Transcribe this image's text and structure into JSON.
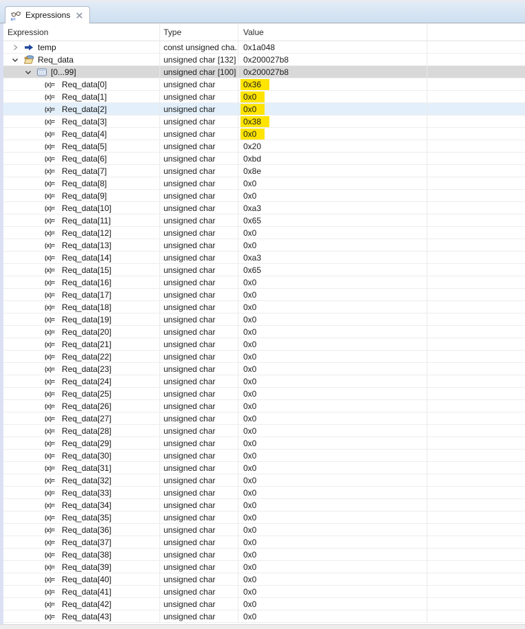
{
  "tab": {
    "label": "Expressions"
  },
  "columns": [
    {
      "label": "Expression"
    },
    {
      "label": "Type"
    },
    {
      "label": "Value"
    },
    {
      "label": ""
    }
  ],
  "glyphs": {
    "variable": "(x)="
  },
  "colors": {
    "topstrip_bg": "#e9eaf2",
    "tabstrip_from": "#e2ecf7",
    "tabstrip_to": "#cddff0",
    "tabstrip_border": "#a4a9b6",
    "tab_border": "#b2b8c8",
    "left_border": "#dbe1f3",
    "col_divider": "#e9e9e9",
    "row_separator": "#ededed",
    "selected_row": "#d9d9d9",
    "hover_row": "#e3f0fb",
    "value_highlight": "#ffe400",
    "scrollbar_bg": "#ededed"
  },
  "rows": [
    {
      "level": 0,
      "chevron": "collapsed",
      "icon": "pointer-arrow",
      "label": "temp",
      "type": "const unsigned cha...",
      "value": "0x1a048"
    },
    {
      "level": 0,
      "chevron": "expanded",
      "icon": "open-folder",
      "label": "Req_data",
      "type": "unsigned char [132]",
      "value": "0x200027b8"
    },
    {
      "level": 1,
      "chevron": "expanded",
      "icon": "array-grid",
      "label": "[0...99]",
      "type": "unsigned char [100]",
      "value": "0x200027b8",
      "bg": "selected"
    },
    {
      "level": 2,
      "chevron": "none",
      "icon": "variable-xequals",
      "label": "Req_data[0]",
      "type": "unsigned char",
      "value": "0x36",
      "hl": true
    },
    {
      "level": 2,
      "chevron": "none",
      "icon": "variable-xequals",
      "label": "Req_data[1]",
      "type": "unsigned char",
      "value": "0x0",
      "hl": true
    },
    {
      "level": 2,
      "chevron": "none",
      "icon": "variable-xequals",
      "label": "Req_data[2]",
      "type": "unsigned char",
      "value": "0x0",
      "hl": true,
      "bg": "hover"
    },
    {
      "level": 2,
      "chevron": "none",
      "icon": "variable-xequals",
      "label": "Req_data[3]",
      "type": "unsigned char",
      "value": "0x38",
      "hl": true
    },
    {
      "level": 2,
      "chevron": "none",
      "icon": "variable-xequals",
      "label": "Req_data[4]",
      "type": "unsigned char",
      "value": "0x0",
      "hl": true
    },
    {
      "level": 2,
      "chevron": "none",
      "icon": "variable-xequals",
      "label": "Req_data[5]",
      "type": "unsigned char",
      "value": "0x20"
    },
    {
      "level": 2,
      "chevron": "none",
      "icon": "variable-xequals",
      "label": "Req_data[6]",
      "type": "unsigned char",
      "value": "0xbd"
    },
    {
      "level": 2,
      "chevron": "none",
      "icon": "variable-xequals",
      "label": "Req_data[7]",
      "type": "unsigned char",
      "value": "0x8e"
    },
    {
      "level": 2,
      "chevron": "none",
      "icon": "variable-xequals",
      "label": "Req_data[8]",
      "type": "unsigned char",
      "value": "0x0"
    },
    {
      "level": 2,
      "chevron": "none",
      "icon": "variable-xequals",
      "label": "Req_data[9]",
      "type": "unsigned char",
      "value": "0x0"
    },
    {
      "level": 2,
      "chevron": "none",
      "icon": "variable-xequals",
      "label": "Req_data[10]",
      "type": "unsigned char",
      "value": "0xa3"
    },
    {
      "level": 2,
      "chevron": "none",
      "icon": "variable-xequals",
      "label": "Req_data[11]",
      "type": "unsigned char",
      "value": "0x65"
    },
    {
      "level": 2,
      "chevron": "none",
      "icon": "variable-xequals",
      "label": "Req_data[12]",
      "type": "unsigned char",
      "value": "0x0"
    },
    {
      "level": 2,
      "chevron": "none",
      "icon": "variable-xequals",
      "label": "Req_data[13]",
      "type": "unsigned char",
      "value": "0x0"
    },
    {
      "level": 2,
      "chevron": "none",
      "icon": "variable-xequals",
      "label": "Req_data[14]",
      "type": "unsigned char",
      "value": "0xa3"
    },
    {
      "level": 2,
      "chevron": "none",
      "icon": "variable-xequals",
      "label": "Req_data[15]",
      "type": "unsigned char",
      "value": "0x65"
    },
    {
      "level": 2,
      "chevron": "none",
      "icon": "variable-xequals",
      "label": "Req_data[16]",
      "type": "unsigned char",
      "value": "0x0"
    },
    {
      "level": 2,
      "chevron": "none",
      "icon": "variable-xequals",
      "label": "Req_data[17]",
      "type": "unsigned char",
      "value": "0x0"
    },
    {
      "level": 2,
      "chevron": "none",
      "icon": "variable-xequals",
      "label": "Req_data[18]",
      "type": "unsigned char",
      "value": "0x0"
    },
    {
      "level": 2,
      "chevron": "none",
      "icon": "variable-xequals",
      "label": "Req_data[19]",
      "type": "unsigned char",
      "value": "0x0"
    },
    {
      "level": 2,
      "chevron": "none",
      "icon": "variable-xequals",
      "label": "Req_data[20]",
      "type": "unsigned char",
      "value": "0x0"
    },
    {
      "level": 2,
      "chevron": "none",
      "icon": "variable-xequals",
      "label": "Req_data[21]",
      "type": "unsigned char",
      "value": "0x0"
    },
    {
      "level": 2,
      "chevron": "none",
      "icon": "variable-xequals",
      "label": "Req_data[22]",
      "type": "unsigned char",
      "value": "0x0"
    },
    {
      "level": 2,
      "chevron": "none",
      "icon": "variable-xequals",
      "label": "Req_data[23]",
      "type": "unsigned char",
      "value": "0x0"
    },
    {
      "level": 2,
      "chevron": "none",
      "icon": "variable-xequals",
      "label": "Req_data[24]",
      "type": "unsigned char",
      "value": "0x0"
    },
    {
      "level": 2,
      "chevron": "none",
      "icon": "variable-xequals",
      "label": "Req_data[25]",
      "type": "unsigned char",
      "value": "0x0"
    },
    {
      "level": 2,
      "chevron": "none",
      "icon": "variable-xequals",
      "label": "Req_data[26]",
      "type": "unsigned char",
      "value": "0x0"
    },
    {
      "level": 2,
      "chevron": "none",
      "icon": "variable-xequals",
      "label": "Req_data[27]",
      "type": "unsigned char",
      "value": "0x0"
    },
    {
      "level": 2,
      "chevron": "none",
      "icon": "variable-xequals",
      "label": "Req_data[28]",
      "type": "unsigned char",
      "value": "0x0"
    },
    {
      "level": 2,
      "chevron": "none",
      "icon": "variable-xequals",
      "label": "Req_data[29]",
      "type": "unsigned char",
      "value": "0x0"
    },
    {
      "level": 2,
      "chevron": "none",
      "icon": "variable-xequals",
      "label": "Req_data[30]",
      "type": "unsigned char",
      "value": "0x0"
    },
    {
      "level": 2,
      "chevron": "none",
      "icon": "variable-xequals",
      "label": "Req_data[31]",
      "type": "unsigned char",
      "value": "0x0"
    },
    {
      "level": 2,
      "chevron": "none",
      "icon": "variable-xequals",
      "label": "Req_data[32]",
      "type": "unsigned char",
      "value": "0x0"
    },
    {
      "level": 2,
      "chevron": "none",
      "icon": "variable-xequals",
      "label": "Req_data[33]",
      "type": "unsigned char",
      "value": "0x0"
    },
    {
      "level": 2,
      "chevron": "none",
      "icon": "variable-xequals",
      "label": "Req_data[34]",
      "type": "unsigned char",
      "value": "0x0"
    },
    {
      "level": 2,
      "chevron": "none",
      "icon": "variable-xequals",
      "label": "Req_data[35]",
      "type": "unsigned char",
      "value": "0x0"
    },
    {
      "level": 2,
      "chevron": "none",
      "icon": "variable-xequals",
      "label": "Req_data[36]",
      "type": "unsigned char",
      "value": "0x0"
    },
    {
      "level": 2,
      "chevron": "none",
      "icon": "variable-xequals",
      "label": "Req_data[37]",
      "type": "unsigned char",
      "value": "0x0"
    },
    {
      "level": 2,
      "chevron": "none",
      "icon": "variable-xequals",
      "label": "Req_data[38]",
      "type": "unsigned char",
      "value": "0x0"
    },
    {
      "level": 2,
      "chevron": "none",
      "icon": "variable-xequals",
      "label": "Req_data[39]",
      "type": "unsigned char",
      "value": "0x0"
    },
    {
      "level": 2,
      "chevron": "none",
      "icon": "variable-xequals",
      "label": "Req_data[40]",
      "type": "unsigned char",
      "value": "0x0"
    },
    {
      "level": 2,
      "chevron": "none",
      "icon": "variable-xequals",
      "label": "Req_data[41]",
      "type": "unsigned char",
      "value": "0x0"
    },
    {
      "level": 2,
      "chevron": "none",
      "icon": "variable-xequals",
      "label": "Req_data[42]",
      "type": "unsigned char",
      "value": "0x0"
    },
    {
      "level": 2,
      "chevron": "none",
      "icon": "variable-xequals",
      "label": "Req_data[43]",
      "type": "unsigned char",
      "value": "0x0"
    }
  ]
}
